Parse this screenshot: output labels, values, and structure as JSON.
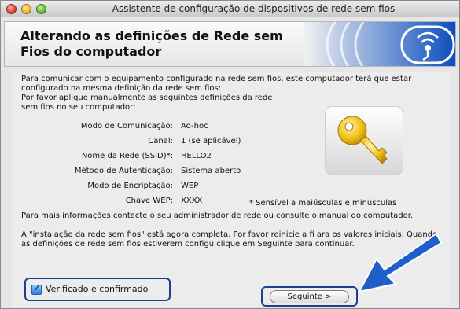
{
  "window": {
    "title": "Assistente de configuração de dispositivos de rede sem fios"
  },
  "header": {
    "title": "Alterando as definições de Rede sem Fios do computador"
  },
  "content": {
    "intro1": "Para comunicar com o equipamento configurado na rede sem fios, este computador terá que estar configurado na mesma definição da rede sem fios:",
    "intro2": "Por favor aplique manualmente as seguintes definições da rede sem fios no seu computador:",
    "settings": [
      {
        "label": "Modo de Comunicação:",
        "value": "Ad-hoc"
      },
      {
        "label": "Canal:",
        "value": "1   (se aplicável)"
      },
      {
        "label": "Nome da Rede (SSID)*:",
        "value": "HELLO2"
      },
      {
        "label": "Método de Autenticação:",
        "value": "Sistema aberto"
      },
      {
        "label": "Modo de Encriptação:",
        "value": "WEP"
      },
      {
        "label": "Chave WEP:",
        "value": "XXXX"
      }
    ],
    "note": "* Sensível a maiúsculas e minúsculas",
    "more_info": "Para mais informações contacte o seu administrador de rede ou consulte o manual do computador.",
    "complete": "A \"instalação da rede sem fios\" está agora completa. Por favor reinicie a fi        ara os valores iniciais. Quando as definições de rede sem fios estiverem configu        clique em Seguinte  para continuar."
  },
  "checkbox": {
    "label": "Verificado e confirmado",
    "checked": true
  },
  "buttons": {
    "next_label": "Seguinte >"
  },
  "colors": {
    "highlight": "#1d3f8f",
    "arrow": "#1f5fc9",
    "key": "#f2c21b"
  },
  "icons": [
    "wifi-signal-icon",
    "key-icon",
    "arrow-pointer-icon",
    "checkmark-icon"
  ]
}
